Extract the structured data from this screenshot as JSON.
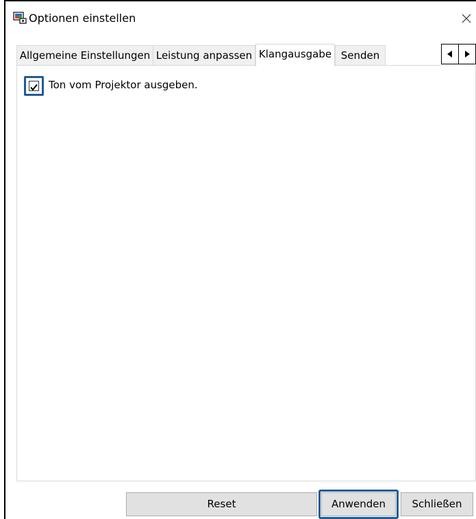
{
  "window": {
    "title": "Optionen einstellen"
  },
  "tabs": [
    {
      "label": "Allgemeine Einstellungen",
      "active": false
    },
    {
      "label": "Leistung anpassen",
      "active": false
    },
    {
      "label": "Klangausgabe",
      "active": true
    },
    {
      "label": "Senden",
      "active": false
    }
  ],
  "tab_scroll": {
    "left_icon": "triangle-left-icon",
    "right_icon": "triangle-right-icon"
  },
  "panel": {
    "checkbox_label": "Ton vom Projektor ausgeben.",
    "checkbox_checked": true
  },
  "buttons": {
    "reset": "Reset",
    "apply": "Anwenden",
    "close": "Schließen"
  },
  "colors": {
    "highlight": "#1f5c99",
    "button_bg": "#e1e1e1",
    "tab_bg": "#f0f0f0"
  }
}
